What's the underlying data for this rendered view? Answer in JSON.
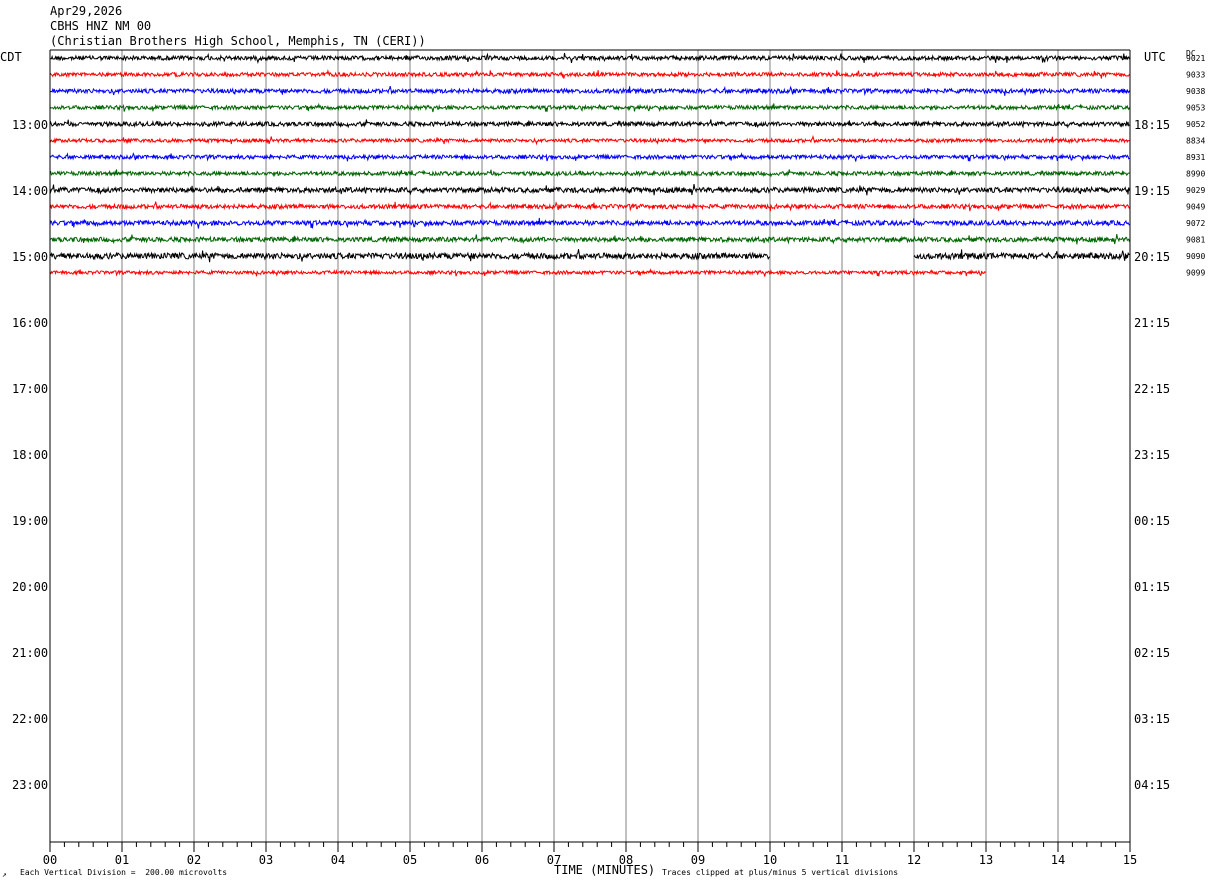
{
  "header": {
    "date": "Apr29,2026",
    "station": "CBHS HNZ NM 00",
    "location": "(Christian Brothers High School, Memphis, TN (CERI))"
  },
  "left_axis_title": "CDT",
  "right_axis_title": "UTC",
  "dc_label": "DC",
  "footer": {
    "scale": "Each Vertical Division =  200.00 microvolts",
    "xlabel": "TIME (MINUTES)",
    "clip": "Traces clipped at plus/minus 5 vertical divisions"
  },
  "colors": {
    "trace_cycle": [
      "#000000",
      "#ff0000",
      "#0000ff",
      "#006400"
    ],
    "grid": "#808080"
  },
  "chart_data": {
    "type": "line",
    "title": "CBHS HNZ NM 00",
    "xlabel": "TIME (MINUTES)",
    "x_ticks": [
      "00",
      "01",
      "02",
      "03",
      "04",
      "05",
      "06",
      "07",
      "08",
      "09",
      "10",
      "11",
      "12",
      "13",
      "14",
      "15"
    ],
    "xlim": [
      0,
      15
    ],
    "left_hour_labels": [
      "13:00",
      "14:00",
      "15:00",
      "16:00",
      "17:00",
      "18:00",
      "19:00",
      "20:00",
      "21:00",
      "22:00",
      "23:00"
    ],
    "right_hour_labels": [
      "18:15",
      "19:15",
      "20:15",
      "21:15",
      "22:15",
      "23:15",
      "00:15",
      "01:15",
      "02:15",
      "03:15",
      "04:15"
    ],
    "rows_per_hour": 4,
    "first_row_offset_from_first_label": -4,
    "traces": [
      {
        "dc": "9021",
        "color": "#000000",
        "segments": [
          [
            0,
            15
          ]
        ],
        "amp": 1.0
      },
      {
        "dc": "9033",
        "color": "#ff0000",
        "segments": [
          [
            0,
            15
          ]
        ],
        "amp": 0.9
      },
      {
        "dc": "9038",
        "color": "#0000ff",
        "segments": [
          [
            0,
            15
          ]
        ],
        "amp": 1.0
      },
      {
        "dc": "9053",
        "color": "#006400",
        "segments": [
          [
            0,
            15
          ]
        ],
        "amp": 0.9
      },
      {
        "dc": "9052",
        "color": "#000000",
        "segments": [
          [
            0,
            15
          ]
        ],
        "amp": 1.0
      },
      {
        "dc": "8834",
        "color": "#ff0000",
        "segments": [
          [
            0,
            15
          ]
        ],
        "amp": 0.8
      },
      {
        "dc": "8931",
        "color": "#0000ff",
        "segments": [
          [
            0,
            15
          ]
        ],
        "amp": 0.9
      },
      {
        "dc": "8990",
        "color": "#006400",
        "segments": [
          [
            0,
            15
          ]
        ],
        "amp": 0.9
      },
      {
        "dc": "9029",
        "color": "#000000",
        "segments": [
          [
            0,
            15
          ]
        ],
        "amp": 1.2
      },
      {
        "dc": "9049",
        "color": "#ff0000",
        "segments": [
          [
            0,
            15
          ]
        ],
        "amp": 1.0
      },
      {
        "dc": "9072",
        "color": "#0000ff",
        "segments": [
          [
            0,
            15
          ]
        ],
        "amp": 1.1
      },
      {
        "dc": "9081",
        "color": "#006400",
        "segments": [
          [
            0,
            15
          ]
        ],
        "amp": 1.1
      },
      {
        "dc": "9090",
        "color": "#000000",
        "segments": [
          [
            0,
            10
          ],
          [
            12,
            15
          ]
        ],
        "amp": 1.4
      },
      {
        "dc": "9099",
        "color": "#ff0000",
        "segments": [
          [
            0,
            13
          ]
        ],
        "amp": 0.8
      }
    ]
  }
}
